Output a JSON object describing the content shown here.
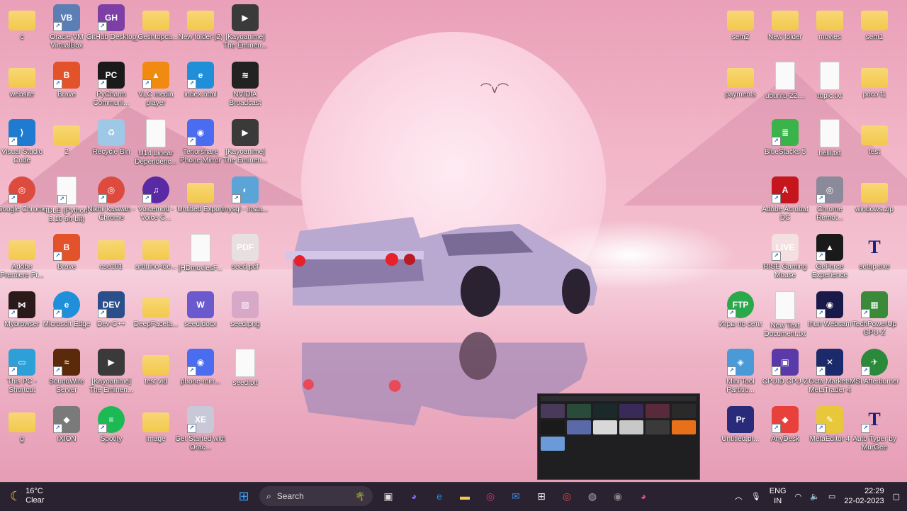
{
  "desktop": {
    "icons": [
      {
        "label": "c",
        "kind": "folder",
        "shortcut": false
      },
      {
        "label": "Oracle VM VirtualBox",
        "kind": "app",
        "color": "#5b7fb5",
        "glyph": "VB",
        "shortcut": true
      },
      {
        "label": "GitHub Desktop",
        "kind": "app",
        "color": "#7b3fa6",
        "glyph": "GH",
        "shortcut": true
      },
      {
        "label": "_Getintopca...",
        "kind": "folder",
        "shortcut": false
      },
      {
        "label": "New folder (2)",
        "kind": "folder",
        "shortcut": false
      },
      {
        "label": "[Kayoanime] The Eminen...",
        "kind": "app",
        "color": "#3a3a3a",
        "glyph": "▶",
        "shortcut": false
      },
      {
        "label": "website",
        "kind": "folder",
        "shortcut": false
      },
      {
        "label": "Brave",
        "kind": "app",
        "color": "#e2522b",
        "glyph": "B",
        "shortcut": true
      },
      {
        "label": "PyCharm Communi...",
        "kind": "app",
        "color": "#1a1a1a",
        "glyph": "PC",
        "shortcut": true
      },
      {
        "label": "VLC media player",
        "kind": "app",
        "color": "#f08a10",
        "glyph": "▲",
        "shortcut": true
      },
      {
        "label": "index.html",
        "kind": "app",
        "color": "#1e8fd8",
        "glyph": "e",
        "shortcut": true
      },
      {
        "label": "NVIDIA Broadcast",
        "kind": "app",
        "color": "#222",
        "glyph": "≋",
        "shortcut": false
      },
      {
        "label": "Visual Studio Code",
        "kind": "app",
        "color": "#1f7bd0",
        "glyph": "⟩",
        "shortcut": true
      },
      {
        "label": "2",
        "kind": "folder",
        "shortcut": false
      },
      {
        "label": "Recycle Bin",
        "kind": "app",
        "color": "#9fc7e6",
        "glyph": "♻",
        "shortcut": false
      },
      {
        "label": "U14 Linear Dependenc...",
        "kind": "doc",
        "shortcut": false
      },
      {
        "label": "Tenorshare Phone Mirror",
        "kind": "app",
        "color": "#4a6cf0",
        "glyph": "◉",
        "shortcut": true
      },
      {
        "label": "[Kayoanime] The Eminen...",
        "kind": "app",
        "color": "#3a3a3a",
        "glyph": "▶",
        "shortcut": false
      },
      {
        "label": "Google Chrome",
        "kind": "app",
        "color": "#dd4b3e",
        "glyph": "◎",
        "shortcut": true,
        "round": true
      },
      {
        "label": "IDLE (Python 3.10 64-bit)",
        "kind": "doc",
        "shortcut": true
      },
      {
        "label": "Nikhil kaswan - Chrome",
        "kind": "app",
        "color": "#dd4b3e",
        "glyph": "◎",
        "shortcut": true,
        "round": true
      },
      {
        "label": "Voicemod - Voice C...",
        "kind": "app",
        "color": "#5a2aa5",
        "glyph": "♫",
        "shortcut": true,
        "round": true
      },
      {
        "label": "Untitled Export",
        "kind": "folder",
        "shortcut": false
      },
      {
        "label": "mysql - insta...",
        "kind": "app",
        "color": "#5aa4d8",
        "glyph": "◐",
        "shortcut": true
      },
      {
        "label": "Adobe Premiere Pr...",
        "kind": "folder",
        "shortcut": false
      },
      {
        "label": "Brave",
        "kind": "app",
        "color": "#e2522b",
        "glyph": "B",
        "shortcut": true
      },
      {
        "label": "cse101",
        "kind": "folder",
        "shortcut": false
      },
      {
        "label": "arduino-ide...",
        "kind": "folder",
        "shortcut": false
      },
      {
        "label": "[HDmoviesF...",
        "kind": "doc",
        "shortcut": false
      },
      {
        "label": "seed.pdf",
        "kind": "app",
        "color": "#e8e0e0",
        "glyph": "PDF",
        "shortcut": false
      },
      {
        "label": "Mybrowser",
        "kind": "app",
        "color": "#2a1a1a",
        "glyph": "⋈",
        "shortcut": true
      },
      {
        "label": "Microsoft Edge",
        "kind": "app",
        "color": "#1e8fd8",
        "glyph": "e",
        "shortcut": true,
        "round": true
      },
      {
        "label": "Dev-C++",
        "kind": "app",
        "color": "#2a4f8a",
        "glyph": "DEV",
        "shortcut": true
      },
      {
        "label": "DeepFacela...",
        "kind": "folder",
        "shortcut": false
      },
      {
        "label": "seed.docx",
        "kind": "app",
        "color": "#6a5acd",
        "glyph": "W",
        "shortcut": false
      },
      {
        "label": "seed.png",
        "kind": "app",
        "color": "#d8a8c8",
        "glyph": "▨",
        "shortcut": false
      },
      {
        "label": "This PC - Shortcut",
        "kind": "app",
        "color": "#2ea0d8",
        "glyph": "▭",
        "shortcut": true
      },
      {
        "label": "SoundWire Server",
        "kind": "app",
        "color": "#5a2a0a",
        "glyph": "≈",
        "shortcut": true
      },
      {
        "label": "[Kayoanime] The Eminen...",
        "kind": "app",
        "color": "#3a3a3a",
        "glyph": "▶",
        "shortcut": false
      },
      {
        "label": "test vid",
        "kind": "folder",
        "shortcut": false
      },
      {
        "label": "phone-mirr...",
        "kind": "app",
        "color": "#4a6cf0",
        "glyph": "◉",
        "shortcut": true
      },
      {
        "label": "seed.txt",
        "kind": "doc",
        "shortcut": false
      },
      {
        "label": "g",
        "kind": "folder",
        "shortcut": false
      },
      {
        "label": "IXION",
        "kind": "app",
        "color": "#7a7a7a",
        "glyph": "◆",
        "shortcut": true
      },
      {
        "label": "Spotify",
        "kind": "app",
        "color": "#1db954",
        "glyph": "≡",
        "shortcut": true,
        "round": true
      },
      {
        "label": "image",
        "kind": "folder",
        "shortcut": false
      },
      {
        "label": "Get Started with Orac...",
        "kind": "app",
        "color": "#c8c8d8",
        "glyph": "XE",
        "shortcut": true
      }
    ],
    "right_icons": [
      {
        "label": "sem2",
        "kind": "folder",
        "shortcut": false
      },
      {
        "label": "New folder",
        "kind": "folder",
        "shortcut": false
      },
      {
        "label": "movies",
        "kind": "folder",
        "shortcut": false
      },
      {
        "label": "sem1",
        "kind": "folder",
        "shortcut": false
      },
      {
        "label": "payments",
        "kind": "folder",
        "shortcut": false
      },
      {
        "label": "ubuntu-22....",
        "kind": "doc",
        "shortcut": false
      },
      {
        "label": "topic.txt",
        "kind": "doc",
        "shortcut": false
      },
      {
        "label": "poco f1",
        "kind": "folder",
        "shortcut": false
      },
      {
        "label": "BlueStacks 5",
        "kind": "app",
        "color": "#3ab34a",
        "glyph": "≣",
        "shortcut": true
      },
      {
        "label": "helll.txt",
        "kind": "doc",
        "shortcut": false
      },
      {
        "label": "test",
        "kind": "folder",
        "shortcut": false
      },
      {
        "label": "Adobe Acrobat DC",
        "kind": "app",
        "color": "#c4161c",
        "glyph": "A",
        "shortcut": true
      },
      {
        "label": "Chrome Remot...",
        "kind": "app",
        "color": "#8a8a9a",
        "glyph": "◎",
        "shortcut": true
      },
      {
        "label": "windows.zip",
        "kind": "folder",
        "shortcut": false
      },
      {
        "label": "RISE Gaming Mouse",
        "kind": "app",
        "color": "#f4e0e0",
        "glyph": "LIVE",
        "shortcut": true
      },
      {
        "label": "GeForce Experience",
        "kind": "app",
        "color": "#1a1a1a",
        "glyph": "▲",
        "shortcut": true
      },
      {
        "label": "setup.exe",
        "kind": "app",
        "color": "transparent",
        "glyph": "T",
        "shortcut": false
      },
      {
        "label": "Игры по сети",
        "kind": "app",
        "color": "#2aa84a",
        "glyph": "FTP",
        "shortcut": true,
        "round": true
      },
      {
        "label": "New Text Document.txt",
        "kind": "doc",
        "shortcut": false
      },
      {
        "label": "Iriun Webcam",
        "kind": "app",
        "color": "#1a1a4a",
        "glyph": "◉",
        "shortcut": true
      },
      {
        "label": "TechPowerUp GPU-Z",
        "kind": "app",
        "color": "#3a8a3a",
        "glyph": "▦",
        "shortcut": true
      },
      {
        "label": "Mini Tool Partitio...",
        "kind": "app",
        "color": "#4a9ad8",
        "glyph": "◈",
        "shortcut": true
      },
      {
        "label": "CPUID CPU-Z",
        "kind": "app",
        "color": "#5a3aa8",
        "glyph": "▣",
        "shortcut": true
      },
      {
        "label": "Octa Markets MetaTrader 4",
        "kind": "app",
        "color": "#1a2a6a",
        "glyph": "✕",
        "shortcut": true
      },
      {
        "label": "MSI Afterburner",
        "kind": "app",
        "color": "#2a8a3a",
        "glyph": "✈",
        "shortcut": true,
        "round": true
      },
      {
        "label": "Untitled.pr...",
        "kind": "app",
        "color": "#2a2a7a",
        "glyph": "Pr",
        "shortcut": false
      },
      {
        "label": "AnyDesk",
        "kind": "app",
        "color": "#e8403a",
        "glyph": "◆",
        "shortcut": true
      },
      {
        "label": "MetaEditor 4",
        "kind": "app",
        "color": "#e8c83a",
        "glyph": "✎",
        "shortcut": true
      },
      {
        "label": "Auto Typer by MurGee",
        "kind": "app",
        "color": "transparent",
        "glyph": "T",
        "shortcut": true
      }
    ]
  },
  "taskbar": {
    "weather": {
      "temp": "16°C",
      "condition": "Clear",
      "icon": "moon-icon"
    },
    "search_label": "Search",
    "pinned": [
      {
        "name": "start-button",
        "glyph": "⊞",
        "color": "#3aa0f0"
      },
      {
        "name": "task-view-icon",
        "glyph": "▣",
        "color": "#ddd"
      },
      {
        "name": "teams-chat-icon",
        "glyph": "◕",
        "color": "#7b6cf0"
      },
      {
        "name": "edge-icon",
        "glyph": "e",
        "color": "#1e8fd8"
      },
      {
        "name": "file-explorer-icon",
        "glyph": "▬",
        "color": "#f2c94c"
      },
      {
        "name": "instagram-icon",
        "glyph": "◎",
        "color": "#d6336c"
      },
      {
        "name": "mail-icon",
        "glyph": "✉",
        "color": "#3a8ad8"
      },
      {
        "name": "store-icon",
        "glyph": "⊞",
        "color": "#e8e8e8"
      },
      {
        "name": "chrome-icon",
        "glyph": "◎",
        "color": "#dd4b3e"
      },
      {
        "name": "disk-icon",
        "glyph": "◍",
        "color": "#aaa"
      },
      {
        "name": "obs-icon",
        "glyph": "◉",
        "color": "#888"
      },
      {
        "name": "color-app-icon",
        "glyph": "◕",
        "color": "#e04a8a"
      }
    ],
    "tray": {
      "lang_top": "ENG",
      "lang_bottom": "IN",
      "time": "22:29",
      "date": "22-02-2023"
    }
  },
  "colors": {
    "taskbar_bg": "#2a2230",
    "wallpaper_tint": "#f2b6c8"
  }
}
